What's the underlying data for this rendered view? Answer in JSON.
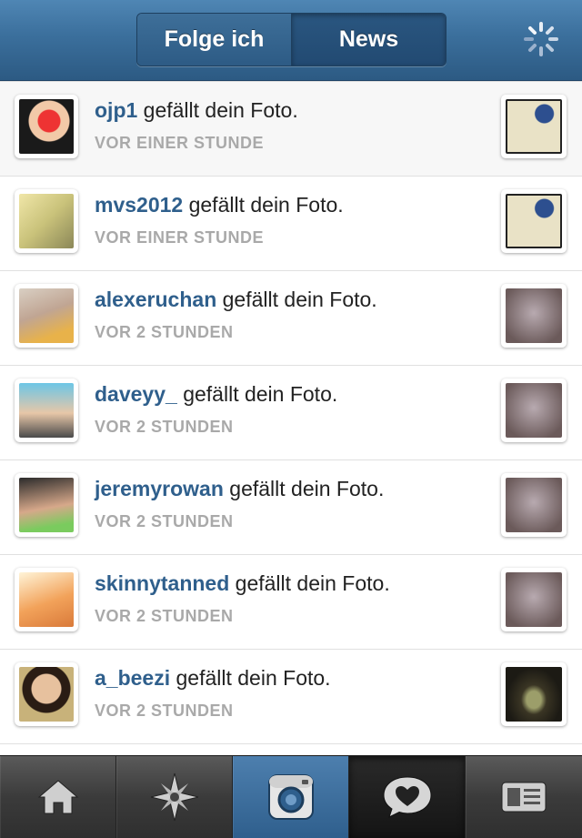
{
  "header": {
    "segment_left": "Folge ich",
    "segment_right": "News",
    "segment_active": "News"
  },
  "rows": [
    {
      "user": "ojp1",
      "action": "gefällt dein Foto.",
      "time": "VOR EINER STUNDE"
    },
    {
      "user": "mvs2012",
      "action": "gefällt dein Foto.",
      "time": "VOR EINER STUNDE"
    },
    {
      "user": "alexeruchan",
      "action": "gefällt dein Foto.",
      "time": "VOR 2 STUNDEN"
    },
    {
      "user": "daveyy_",
      "action": "gefällt dein Foto.",
      "time": "VOR 2 STUNDEN"
    },
    {
      "user": "jeremyrowan",
      "action": "gefällt dein Foto.",
      "time": "VOR 2 STUNDEN"
    },
    {
      "user": "skinnytanned",
      "action": "gefällt dein Foto.",
      "time": "VOR 2 STUNDEN"
    },
    {
      "user": "a_beezi",
      "action": "gefällt dein Foto.",
      "time": "VOR 2 STUNDEN"
    }
  ],
  "tabbar": {
    "items": [
      "home-icon",
      "explore-icon",
      "camera-icon",
      "news-heart-icon",
      "profile-icon"
    ],
    "active": "news-heart-icon"
  },
  "colors": {
    "header_blue": "#3b6f9c",
    "username_blue": "#2f5f8c",
    "timestamp_gray": "#a9a9a9"
  }
}
